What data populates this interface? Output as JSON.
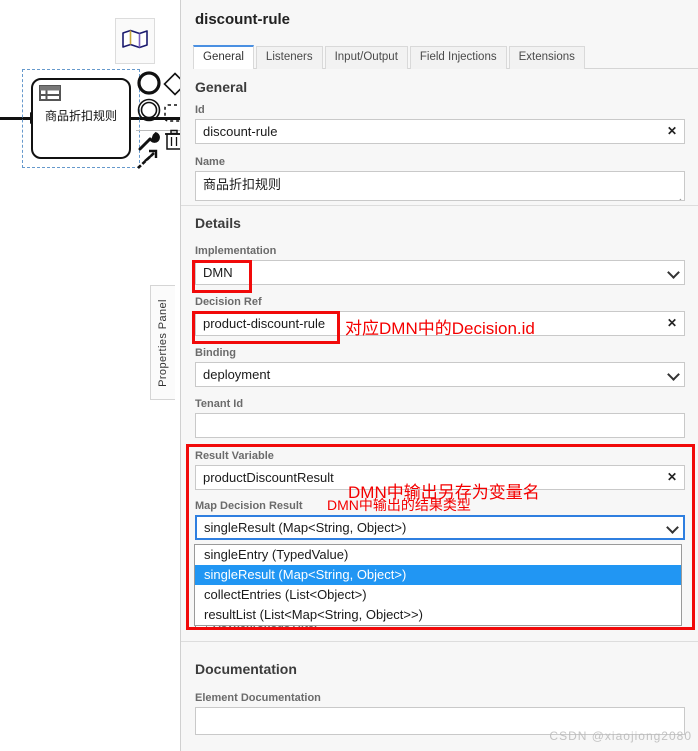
{
  "canvas": {
    "minimap_icon": "map-icon",
    "task": {
      "label": "商品折扣规则",
      "type_icon": "business-rule-task-icon",
      "selected": true
    },
    "context_pad": [
      {
        "name": "append-end-event",
        "icon": "circle-icon"
      },
      {
        "name": "append-gateway",
        "icon": "diamond-icon"
      },
      {
        "name": "append-intermediate-event",
        "icon": "double-circle-icon"
      },
      {
        "name": "append-task",
        "icon": "dotted-rect-icon"
      },
      {
        "name": "change-element",
        "icon": "wrench-icon"
      },
      {
        "name": "delete-element",
        "icon": "trash-icon"
      },
      {
        "name": "connect",
        "icon": "connect-arrow-icon"
      }
    ]
  },
  "panel_handle": {
    "label": "Properties Panel"
  },
  "properties": {
    "title": "discount-rule",
    "tabs": [
      {
        "label": "General",
        "active": true
      },
      {
        "label": "Listeners",
        "active": false
      },
      {
        "label": "Input/Output",
        "active": false
      },
      {
        "label": "Field Injections",
        "active": false
      },
      {
        "label": "Extensions",
        "active": false
      }
    ],
    "general": {
      "heading": "General",
      "id": {
        "label": "Id",
        "value": "discount-rule",
        "clear": "✕"
      },
      "name": {
        "label": "Name",
        "value": "商品折扣规则"
      }
    },
    "details": {
      "heading": "Details",
      "implementation": {
        "label": "Implementation",
        "value": "DMN"
      },
      "decision_ref": {
        "label": "Decision Ref",
        "value": "product-discount-rule",
        "clear": "✕"
      },
      "binding": {
        "label": "Binding",
        "value": "deployment"
      },
      "tenant_id": {
        "label": "Tenant Id",
        "value": ""
      },
      "result_variable": {
        "label": "Result Variable",
        "value": "productDiscountResult",
        "clear": "✕"
      },
      "map_decision_result": {
        "label": "Map Decision Result",
        "value": "singleResult (Map<String, Object>)",
        "options": [
          "singleEntry (TypedValue)",
          "singleResult (Map<String, Object>)",
          "collectEntries (List<Object>)",
          "resultList (List<Map<String, Object>>)"
        ],
        "selected_index": 1
      },
      "asynchronous_after": {
        "label": "Asynchronous After",
        "checked": false
      }
    },
    "documentation": {
      "heading": "Documentation",
      "element_documentation": {
        "label": "Element Documentation",
        "value": ""
      }
    }
  },
  "annotations": [
    {
      "name": "decision-ref-note",
      "text": "对应DMN中的Decision.id"
    },
    {
      "name": "result-variable-note",
      "text": "DMN中输出另存为变量名"
    },
    {
      "name": "map-decision-result-note",
      "text": "DMN中输出的结果类型"
    }
  ],
  "watermark": {
    "text": "CSDN @xiaojiong2080"
  },
  "colors": {
    "accent": "#4a90e2",
    "annotation_red": "#f10a0a",
    "dropdown_highlight": "#2196f3",
    "panel_bg": "#f7f7f7"
  }
}
